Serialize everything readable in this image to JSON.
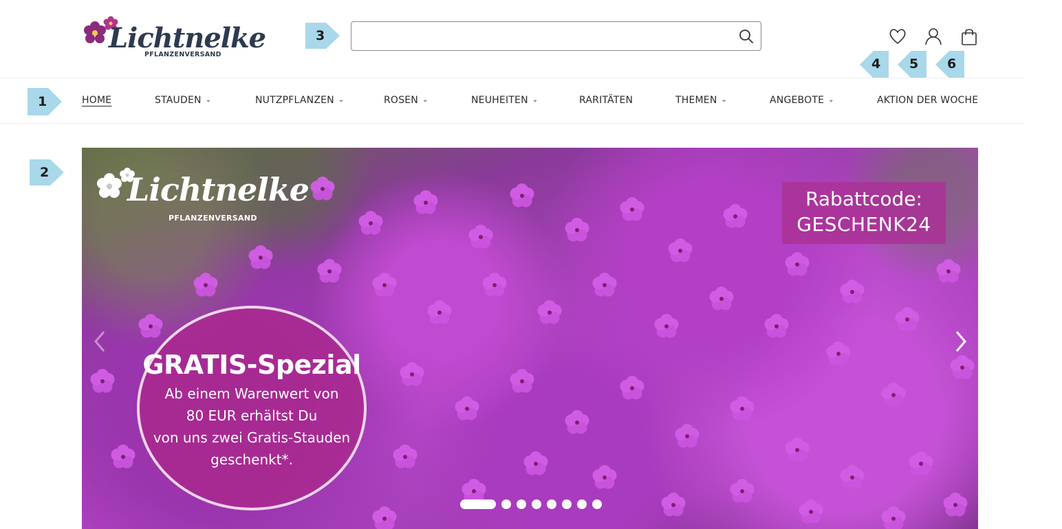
{
  "logo": {
    "name": "Lichtnelke",
    "tagline": "PFLANZENVERSAND"
  },
  "search": {
    "value": "",
    "placeholder": ""
  },
  "header_icons": [
    "heart-icon",
    "user-icon",
    "cart-icon"
  ],
  "nav": {
    "items": [
      {
        "label": "HOME",
        "has_dropdown": false,
        "active": true
      },
      {
        "label": "STAUDEN",
        "has_dropdown": true
      },
      {
        "label": "NUTZPFLANZEN",
        "has_dropdown": true
      },
      {
        "label": "ROSEN",
        "has_dropdown": true
      },
      {
        "label": "NEUHEITEN",
        "has_dropdown": true
      },
      {
        "label": "RARITÄTEN",
        "has_dropdown": false
      },
      {
        "label": "THEMEN",
        "has_dropdown": true
      },
      {
        "label": "ANGEBOTE",
        "has_dropdown": true
      },
      {
        "label": "AKTION DER WOCHE",
        "has_dropdown": false
      }
    ]
  },
  "hero": {
    "logo_name": "Lichtnelke",
    "logo_tagline": "PFLANZENVERSAND",
    "promo_line1": "Rabattcode:",
    "promo_line2": "GESCHENK24",
    "circle_title": "GRATIS-Spezial",
    "circle_line1": "Ab einem Warenwert von",
    "circle_line2": "80 EUR erhältst Du",
    "circle_line3": "von uns zwei Gratis-Stauden",
    "circle_line4": "geschenkt*.",
    "slide_count": 8,
    "active_slide": 1
  },
  "callouts": {
    "c1": "1",
    "c2": "2",
    "c3": "3",
    "c4": "4",
    "c5": "5",
    "c6": "6"
  },
  "colors": {
    "callout": "#a8d8ea",
    "brand_navy": "#2e3a4f",
    "brand_magenta": "#a8327f"
  }
}
